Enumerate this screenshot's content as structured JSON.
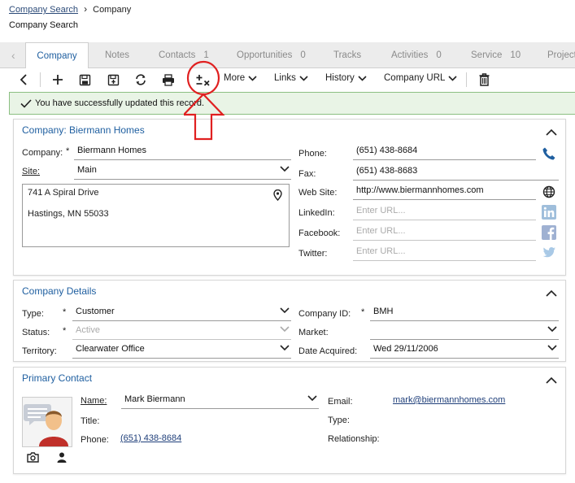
{
  "breadcrumb": {
    "link": "Company Search",
    "current": "Company"
  },
  "page_title": "Company Search",
  "tabs": [
    {
      "label": "Company",
      "count": ""
    },
    {
      "label": "Notes",
      "count": ""
    },
    {
      "label": "Contacts",
      "count": "1"
    },
    {
      "label": "Opportunities",
      "count": "0"
    },
    {
      "label": "Tracks",
      "count": ""
    },
    {
      "label": "Activities",
      "count": "0"
    },
    {
      "label": "Service",
      "count": "10"
    },
    {
      "label": "Projects",
      "count": ""
    }
  ],
  "toolbar": {
    "more": "More",
    "links": "Links",
    "history": "History",
    "company_url": "Company URL"
  },
  "success_message": "You have successfully updated this record.",
  "company_card": {
    "title": "Company: Biermann Homes",
    "company_label": "Company:",
    "company_value": "Biermann Homes",
    "site_label": "Site:",
    "site_value": "Main",
    "address_line1": "741 A Spiral Drive",
    "address_line2": "Hastings, MN 55033",
    "phone_label": "Phone:",
    "phone_value": "(651) 438-8684",
    "fax_label": "Fax:",
    "fax_value": "(651) 438-8683",
    "website_label": "Web Site:",
    "website_value": "http://www.biermannhomes.com",
    "linkedin_label": "LinkedIn:",
    "linkedin_placeholder": "Enter URL...",
    "facebook_label": "Facebook:",
    "facebook_placeholder": "Enter URL...",
    "twitter_label": "Twitter:",
    "twitter_placeholder": "Enter URL..."
  },
  "details_card": {
    "title": "Company Details",
    "type_label": "Type:",
    "type_value": "Customer",
    "status_label": "Status:",
    "status_value": "Active",
    "territory_label": "Territory:",
    "territory_value": "Clearwater Office",
    "company_id_label": "Company ID:",
    "company_id_value": "BMH",
    "market_label": "Market:",
    "market_value": "",
    "date_acquired_label": "Date Acquired:",
    "date_acquired_value": "Wed 29/11/2006"
  },
  "contact_card": {
    "title": "Primary Contact",
    "name_label": "Name:",
    "name_value": "Mark Biermann",
    "title_label": "Title:",
    "title_value": "",
    "phone_label": "Phone:",
    "phone_value": "(651) 438-8684",
    "email_label": "Email:",
    "email_value": "mark@biermannhomes.com",
    "type_label": "Type:",
    "relationship_label": "Relationship:"
  },
  "colors": {
    "accent_blue": "#1f5fa0",
    "success_bg": "#e9f4e6",
    "annotation_red": "#e02020"
  }
}
